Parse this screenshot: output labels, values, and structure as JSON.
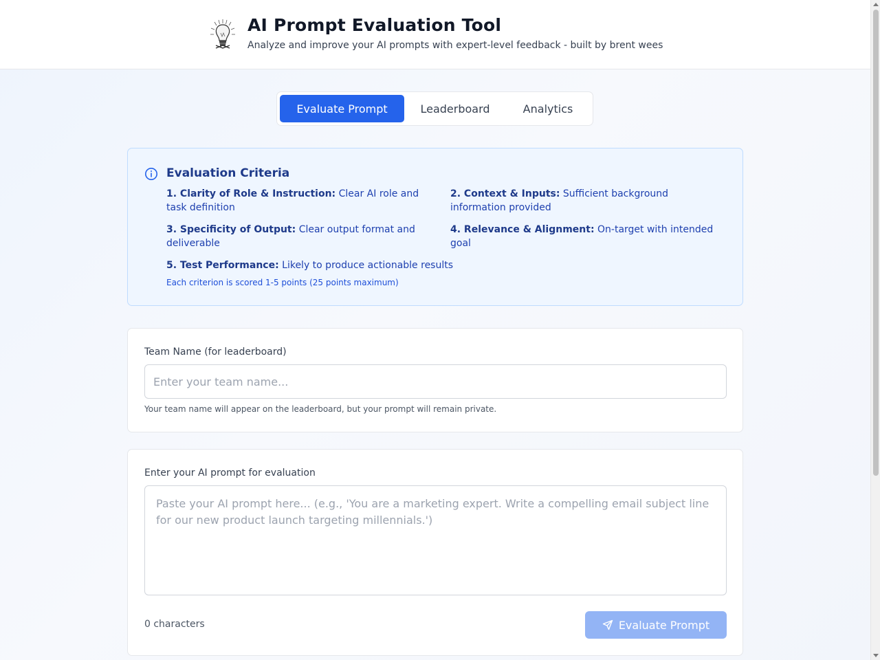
{
  "header": {
    "title": "AI Prompt Evaluation Tool",
    "subtitle": "Analyze and improve your AI prompts with expert-level feedback - built by brent wees",
    "logo_icon": "lightbulb-icon"
  },
  "tabs": [
    {
      "label": "Evaluate Prompt",
      "active": true
    },
    {
      "label": "Leaderboard",
      "active": false
    },
    {
      "label": "Analytics",
      "active": false
    }
  ],
  "criteria": {
    "title": "Evaluation Criteria",
    "icon": "info-icon",
    "items": [
      {
        "heading": "1. Clarity of Role & Instruction:",
        "desc": "Clear AI role and task definition"
      },
      {
        "heading": "2. Context & Inputs:",
        "desc": "Sufficient background information provided"
      },
      {
        "heading": "3. Specificity of Output:",
        "desc": "Clear output format and deliverable"
      },
      {
        "heading": "4. Relevance & Alignment:",
        "desc": "On-target with intended goal"
      },
      {
        "heading": "5. Test Performance:",
        "desc": "Likely to produce actionable results"
      }
    ],
    "note": "Each criterion is scored 1-5 points (25 points maximum)"
  },
  "team": {
    "label": "Team Name (for leaderboard)",
    "value": "",
    "placeholder": "Enter your team name...",
    "helper": "Your team name will appear on the leaderboard, but your prompt will remain private."
  },
  "prompt": {
    "label": "Enter your AI prompt for evaluation",
    "value": "",
    "placeholder": "Paste your AI prompt here... (e.g., 'You are a marketing expert. Write a compelling email subject line for our new product launch targeting millennials.')",
    "char_count": "0 characters",
    "button_label": "Evaluate Prompt",
    "button_icon": "send-icon"
  },
  "colors": {
    "accent": "#2563eb",
    "accent_disabled": "#93b4f5",
    "criteria_bg": "#eff6ff",
    "criteria_text": "#1e3a8a"
  }
}
